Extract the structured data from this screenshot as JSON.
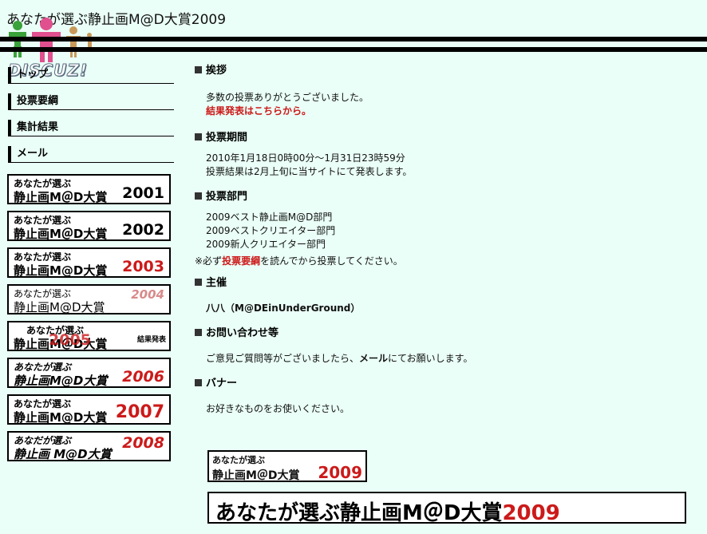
{
  "site": {
    "title": "あなたが選ぶ静止画M@D大賞2009"
  },
  "logo": {
    "text": "DISCUZ!"
  },
  "nav": {
    "items": [
      {
        "label": "トップ"
      },
      {
        "label": "投票要綱"
      },
      {
        "label": "集計結果"
      },
      {
        "label": "メール"
      }
    ]
  },
  "banners": [
    {
      "line1": "あなたが選ぶ",
      "line2": "静止画M＠D大賞",
      "year": "2001",
      "year_color": "#000000"
    },
    {
      "line1": "あなたが選ぶ",
      "line2": "静止画M＠D大賞",
      "year": "2002",
      "year_color": "#000000"
    },
    {
      "line1": "あなたが選ぶ",
      "line2": "静止画M@D大賞",
      "year": "2003",
      "year_color": "#cc1a1a"
    },
    {
      "line1": "あなたが選ぶ",
      "line2": "静止画M@D大賞",
      "year": "2004",
      "year_color": "#d88a8a"
    },
    {
      "line1": "あなたが選ぶ",
      "line2": "静止画M＠D大賞",
      "year": "2005",
      "year_color": "#cc1a1a",
      "note": "結果発表"
    },
    {
      "line1": "あなたが選ぶ",
      "line2": "静止画M@D大賞",
      "year": "2006",
      "year_color": "#cc1a1a"
    },
    {
      "line1": "あなたが選ぶ",
      "line2": "静止画M@D大賞",
      "year": "2007",
      "year_color": "#cc1a1a"
    },
    {
      "line1": "あなだが選ぶ",
      "line2": "静止画 M@D大賞",
      "year": "2008",
      "year_color": "#cc1a1a"
    }
  ],
  "main": {
    "greeting": {
      "heading": "挨拶",
      "line1": "多数の投票ありがとうございました。",
      "link": "結果発表はこちらから。"
    },
    "period": {
      "heading": "投票期間",
      "line1": "2010年1月18日0時00分～1月31日23時59分",
      "line2": "投票結果は2月上旬に当サイトにて発表します。"
    },
    "categories": {
      "heading": "投票部門",
      "items": [
        "2009ベスト静止画M@D部門",
        "2009ベストクリエイター部門",
        "2009新人クリエイター部門"
      ]
    },
    "note": {
      "prefix": "※必ず",
      "link": "投票要綱",
      "suffix": "を読んでから投票してください。"
    },
    "host": {
      "heading": "主催",
      "name": "八八（M@DEinUnderGround）"
    },
    "contact": {
      "heading": "お問い合わせ等",
      "prefix": "ご意見ご質問等がございましたら、",
      "link": "メール",
      "suffix": "にてお願いします。"
    },
    "banner_sec": {
      "heading": "バナー",
      "line1": "お好きなものをお使いください。",
      "small": {
        "line1": "あなたが選ぶ",
        "line2": "静止画M＠D大賞",
        "year": "2009"
      },
      "wide": {
        "text": "あなたが選ぶ静止画M＠D大賞",
        "year": "2009"
      }
    }
  }
}
